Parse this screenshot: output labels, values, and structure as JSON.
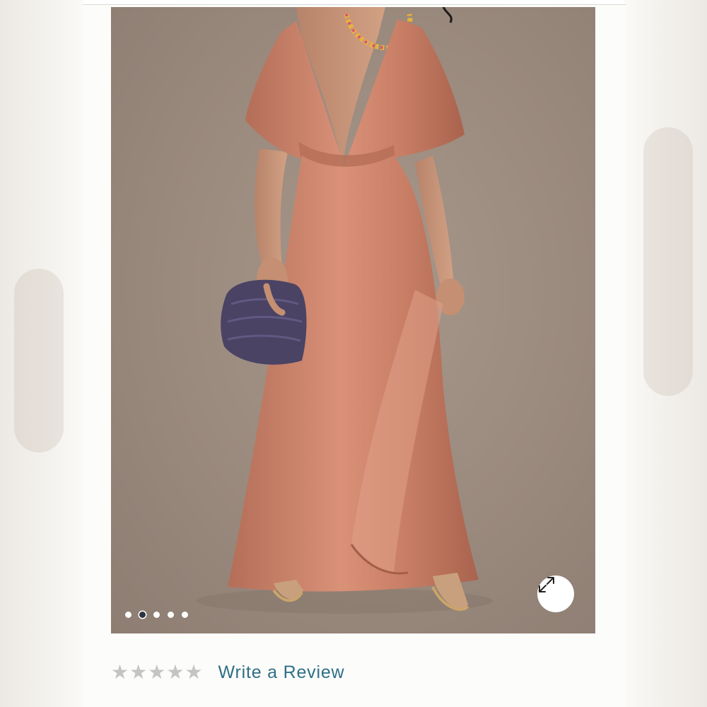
{
  "product": {
    "image_alt": "Model wearing a terracotta satin flutter-sleeve maxi dress holding a purple woven clutch",
    "colors": {
      "dress": "#c9826a",
      "background": "#9a897d",
      "clutch": "#4a4364"
    }
  },
  "carousel": {
    "total_images": 5,
    "active_index": 1
  },
  "expand_button": {
    "icon": "expand-arrows-icon"
  },
  "reviews": {
    "rating": 0,
    "max_rating": 5,
    "star_glyph": "★",
    "write_review_label": "Write a Review",
    "link_color": "#2f6f86"
  }
}
